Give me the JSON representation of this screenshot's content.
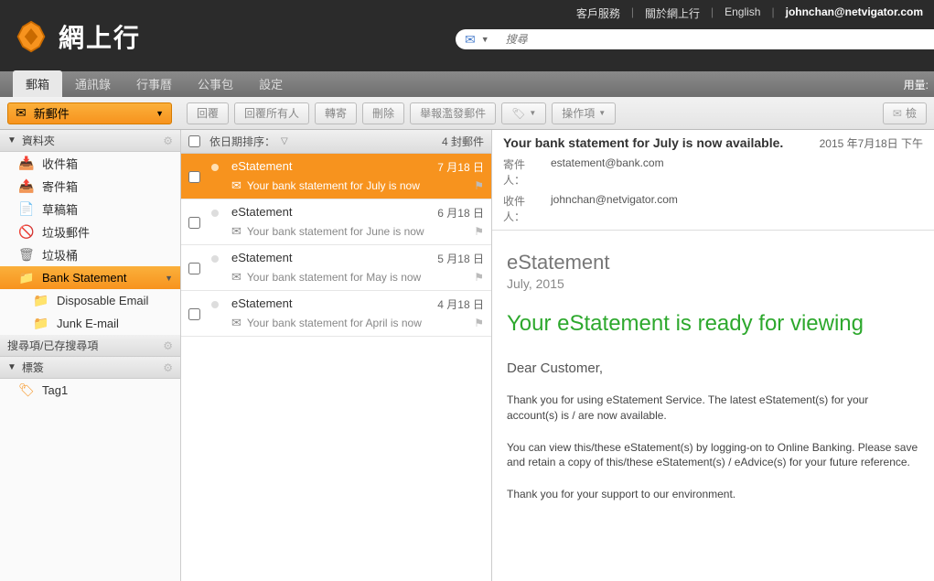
{
  "top": {
    "logo_text": "網上行",
    "nav": {
      "customer_service": "客戶服務",
      "about": "關於網上行",
      "english": "English",
      "user": "johnchan@netvigator.com"
    },
    "search_placeholder": "搜尋"
  },
  "tabs": {
    "mail": "郵箱",
    "contacts": "通訊錄",
    "calendar": "行事曆",
    "briefcase": "公事包",
    "settings": "設定",
    "usage": "用量:"
  },
  "toolbar": {
    "new_mail": "新郵件",
    "reply": "回覆",
    "reply_all": "回覆所有人",
    "forward": "轉寄",
    "delete": "刪除",
    "report_spam": "舉報濫發郵件",
    "actions": "操作項",
    "view": "檢"
  },
  "sidebar": {
    "folders_header": "資料夾",
    "items": {
      "inbox": "收件箱",
      "sent": "寄件箱",
      "drafts": "草稿箱",
      "junk": "垃圾郵件",
      "trash": "垃圾桶",
      "bank": "Bank Statement",
      "disposable": "Disposable Email",
      "junk_email": "Junk E-mail"
    },
    "search_header": "搜尋項/已存搜尋項",
    "tags_header": "標簽",
    "tag1": "Tag1"
  },
  "list": {
    "sort_label": "依日期排序：",
    "count": "4 封郵件",
    "messages": [
      {
        "sender": "eStatement",
        "date": "7 月18 日",
        "subject": "Your bank statement for July is now"
      },
      {
        "sender": "eStatement",
        "date": "6 月18 日",
        "subject": "Your bank statement for June is now"
      },
      {
        "sender": "eStatement",
        "date": "5 月18 日",
        "subject": "Your bank statement for May is now"
      },
      {
        "sender": "eStatement",
        "date": "4 月18 日",
        "subject": "Your bank statement for April is now"
      }
    ]
  },
  "preview": {
    "subject": "Your bank statement for July is now available.",
    "timestamp": "2015 年7月18日 下午",
    "from_label": "寄件人：",
    "from_value": "estatement@bank.com",
    "to_label": "收件人：",
    "to_value": "johnchan@netvigator.com",
    "est_title": "eStatement",
    "est_sub": "July, 2015",
    "headline": "Your eStatement is ready for viewing",
    "dear": "Dear Customer,",
    "p1": "Thank you for using eStatement Service. The latest eStatement(s) for your account(s) is / are now available.",
    "p2": "You can view this/these eStatement(s) by logging-on to Online Banking. Please save and retain a copy of this/these eStatement(s) / eAdvice(s) for your future reference.",
    "p3": "Thank you for your support to our environment."
  }
}
